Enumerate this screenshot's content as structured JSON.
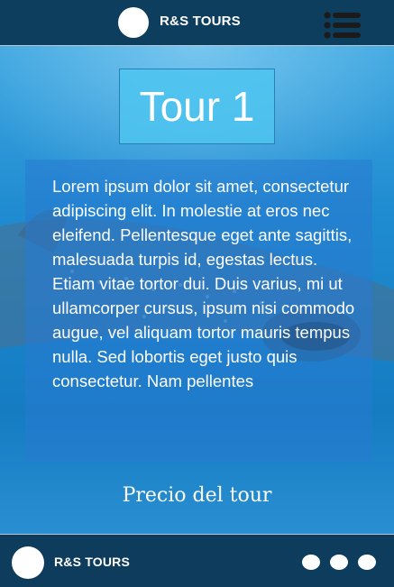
{
  "header": {
    "brand": "R&S TOURS",
    "logo_icon": "logo-circle-icon",
    "menu_icon": "menu-list-icon"
  },
  "hero": {
    "background_icon": "whale-shark-photo",
    "title": "Tour 1",
    "description": "Lorem ipsum dolor sit amet, consectetur adipiscing elit. In molestie at eros nec eleifend. Pellentesque eget ante sagittis, malesuada turpis id, egestas lectus. Etiam vitae tortor dui. Duis varius, mi ut ullamcorper cursus, ipsum nisi commodo augue, vel aliquam tortor mauris tempus nulla. Sed lobortis eget justo quis consectetur. Nam pellentes",
    "price_label": "Precio del tour"
  },
  "footer": {
    "brand": "R&S TOURS",
    "logo_icon": "logo-circle-icon",
    "dots": [
      "social-dot-icon",
      "social-dot-icon",
      "social-dot-icon"
    ]
  },
  "colors": {
    "bar": "#0e3e5e",
    "title_box": "#4ec4f0",
    "text": "#ffffff"
  }
}
